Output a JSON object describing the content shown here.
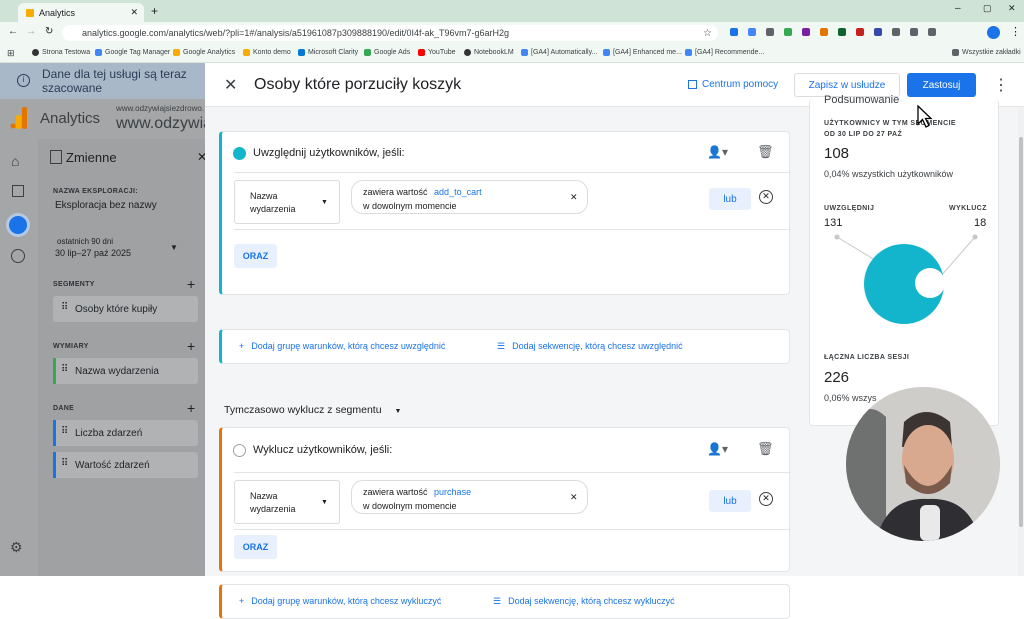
{
  "browser": {
    "tab_title": "Analytics",
    "url": "analytics.google.com/analytics/web/?pli=1#/analysis/a51961087p309888190/edit/0I4f-ak_T96vm7-g6arH2g",
    "bookmarks": [
      "Strona Testowa",
      "Google Tag Manager",
      "Google Analytics",
      "Konto demo",
      "Microsoft Clarity",
      "Google Ads",
      "YouTube",
      "NotebookLM",
      "[GA4] Automatically...",
      "[GA4] Enhanced me...",
      "[GA4] Recommende..."
    ],
    "all_bookmarks": "Wszystkie zakładki"
  },
  "ga": {
    "banner": "Dane dla tej usługi są teraz szacowane",
    "app_name": "Analytics",
    "property_small": "www.odzywiajsiezdrowo.",
    "property_big": "www.odzywia"
  },
  "variables": {
    "title": "Zmienne",
    "exploration_label": "NAZWA EKSPLORACJI:",
    "exploration_name": "Eksploracja bez nazwy",
    "date_label": "ostatnich 90 dni",
    "date_range": "30 lip–27 paź 2025",
    "segments_label": "SEGMENTY",
    "segment_item": "Osoby które kupiły",
    "dimensions_label": "WYMIARY",
    "dimension_item": "Nazwa wydarzenia",
    "data_label": "DANE",
    "metric_items": [
      "Liczba zdarzeń",
      "Wartość zdarzeń"
    ]
  },
  "modal": {
    "title": "Osoby które porzuciły koszyk",
    "help": "Centrum pomocy",
    "save_service": "Zapisz w usłudze",
    "apply": "Zastosuj",
    "include": {
      "heading": "Uwzględnij użytkowników, jeśli:",
      "field_line1": "Nazwa",
      "field_line2": "wydarzenia",
      "cond_prefix": "zawiera wartość",
      "cond_value": "add_to_cart",
      "cond_when": "w dowolnym momencie",
      "or": "lub",
      "and": "ORAZ",
      "add_group": "Dodaj grupę warunków, którą chcesz uwzględnić",
      "add_sequence": "Dodaj sekwencję, którą chcesz uwzględnić"
    },
    "temp_exclude": "Tymczasowo wyklucz z segmentu",
    "exclude": {
      "heading": "Wyklucz użytkowników, jeśli:",
      "field_line1": "Nazwa",
      "field_line2": "wydarzenia",
      "cond_prefix": "zawiera wartość",
      "cond_value": "purchase",
      "cond_when": "w dowolnym momencie",
      "or": "lub",
      "and": "ORAZ",
      "add_group": "Dodaj grupę warunków, którą chcesz wykluczyć",
      "add_sequence": "Dodaj sekwencję, którą chcesz wykluczyć"
    }
  },
  "summary": {
    "title": "Podsumowanie",
    "users_label1": "UŻYTKOWNICY W TYM SEGMENCIE",
    "users_label2": "OD 30 LIP DO 27 PAŹ",
    "users_value": "108",
    "users_pct": "0,04% wszystkich użytkowników",
    "include_label": "UWZGLĘDNIJ",
    "include_value": "131",
    "exclude_label": "WYKLUCZ",
    "exclude_value": "18",
    "sessions_label": "ŁĄCZNA LICZBA SESJI",
    "sessions_value": "226",
    "sessions_pct": "0,06% wszys"
  },
  "colors": {
    "accent": "#1a73e8",
    "teal": "#12b5cb",
    "orange": "#e8710a",
    "ga_orange": "#f9ab00"
  }
}
